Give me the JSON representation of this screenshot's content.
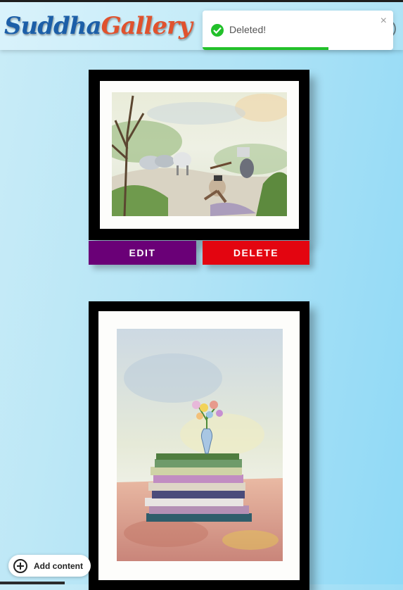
{
  "app": {
    "logo_part1": "Suddha",
    "logo_part2": "Gallery"
  },
  "toast": {
    "message": "Deleted!",
    "close_glyph": "×",
    "progress": 0.66,
    "status": "success",
    "icon": "check-circle-icon",
    "accent_color": "#22c02a"
  },
  "gallery": {
    "items": [
      {
        "artwork": "watercolor-village-goats-painting",
        "edit_label": "EDIT",
        "delete_label": "DELETE"
      },
      {
        "artwork": "watercolor-books-flower-vase-painting"
      }
    ]
  },
  "colors": {
    "edit_button": "#6a0077",
    "delete_button": "#e30510"
  },
  "fab": {
    "label": "Add content",
    "icon": "plus-circle-icon"
  }
}
